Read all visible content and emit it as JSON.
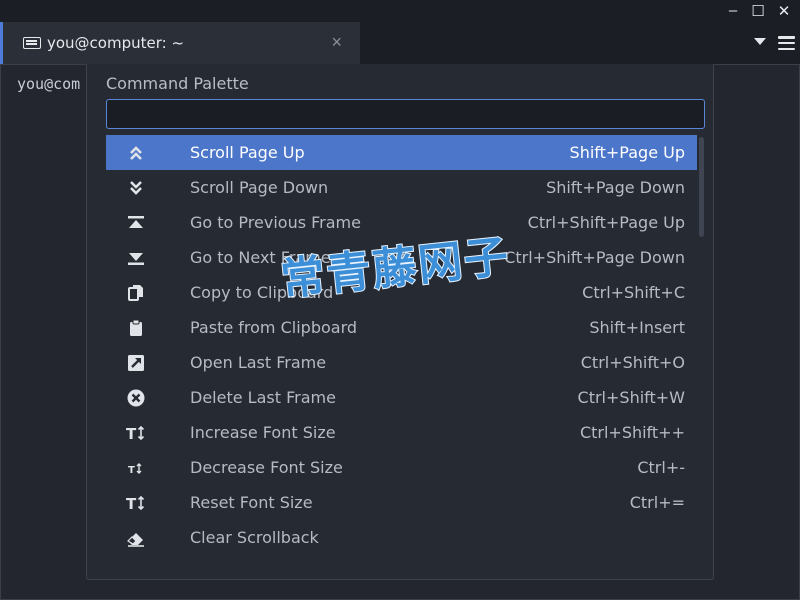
{
  "window": {
    "min_label": "–",
    "max_label": "☐",
    "close_label": "✕"
  },
  "tab": {
    "title": "you@computer: ~",
    "close_label": "×",
    "icon": "keyboard-icon"
  },
  "terminal": {
    "prompt_text": "you@com"
  },
  "palette": {
    "title": "Command Palette",
    "input_value": "",
    "input_placeholder": "",
    "items": [
      {
        "label": "Scroll Page Up",
        "shortcut": "Shift+Page Up",
        "icon": "double-chevron-up-icon",
        "selected": true
      },
      {
        "label": "Scroll Page Down",
        "shortcut": "Shift+Page Down",
        "icon": "double-chevron-down-icon",
        "selected": false
      },
      {
        "label": "Go to Previous Frame",
        "shortcut": "Ctrl+Shift+Page Up",
        "icon": "previous-frame-icon",
        "selected": false
      },
      {
        "label": "Go to Next Frame",
        "shortcut": "Ctrl+Shift+Page Down",
        "icon": "next-frame-icon",
        "selected": false
      },
      {
        "label": "Copy to Clipboard",
        "shortcut": "Ctrl+Shift+C",
        "icon": "copy-icon",
        "selected": false
      },
      {
        "label": "Paste from Clipboard",
        "shortcut": "Shift+Insert",
        "icon": "paste-icon",
        "selected": false
      },
      {
        "label": "Open Last Frame",
        "shortcut": "Ctrl+Shift+O",
        "icon": "open-external-icon",
        "selected": false
      },
      {
        "label": "Delete Last Frame",
        "shortcut": "Ctrl+Shift+W",
        "icon": "delete-circle-icon",
        "selected": false
      },
      {
        "label": "Increase Font Size",
        "shortcut": "Ctrl+Shift++",
        "icon": "font-size-large-icon",
        "selected": false
      },
      {
        "label": "Decrease Font Size",
        "shortcut": "Ctrl+-",
        "icon": "font-size-small-icon",
        "selected": false
      },
      {
        "label": "Reset Font Size",
        "shortcut": "Ctrl+=",
        "icon": "font-size-reset-icon",
        "selected": false
      },
      {
        "label": "Clear Scrollback",
        "shortcut": "",
        "icon": "eraser-icon",
        "selected": false
      }
    ]
  },
  "watermark": {
    "text": "常青藤网子"
  },
  "colors": {
    "accent": "#4c76c9",
    "background": "#23262e",
    "palette_bg": "#262a32",
    "watermark": "#3c8fd6"
  }
}
